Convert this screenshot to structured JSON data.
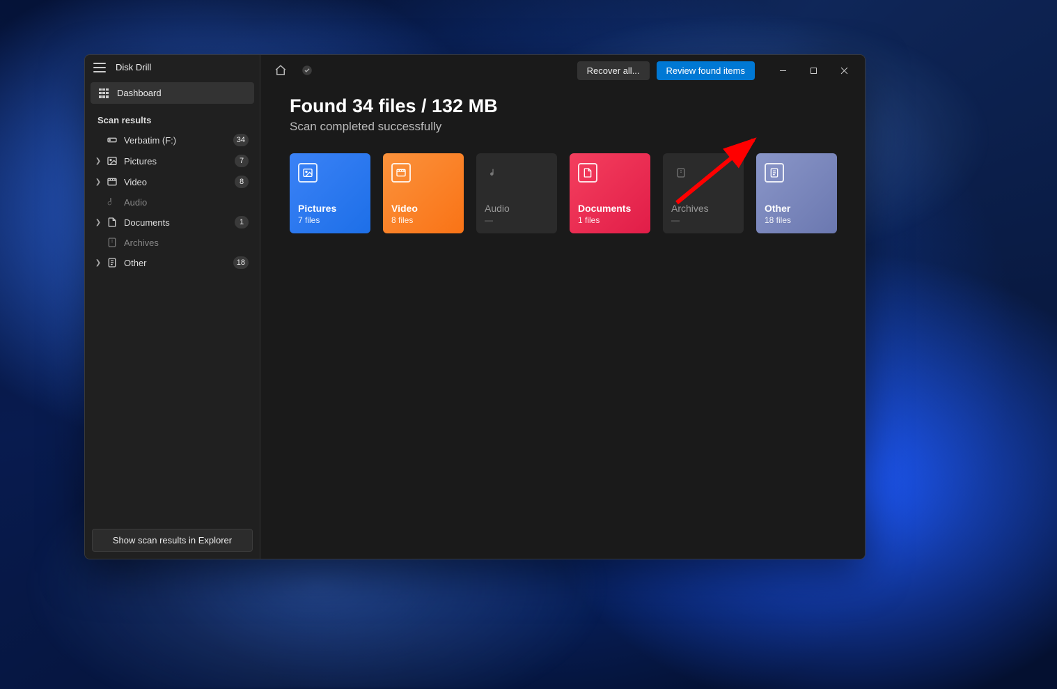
{
  "app": {
    "title": "Disk Drill"
  },
  "sidebar": {
    "dashboard_label": "Dashboard",
    "section_title": "Scan results",
    "items": [
      {
        "label": "Verbatim (F:)",
        "count": "34",
        "icon": "drive",
        "expandable": false,
        "dim": false
      },
      {
        "label": "Pictures",
        "count": "7",
        "icon": "image",
        "expandable": true,
        "dim": false
      },
      {
        "label": "Video",
        "count": "8",
        "icon": "video",
        "expandable": true,
        "dim": false
      },
      {
        "label": "Audio",
        "count": "",
        "icon": "audio",
        "expandable": false,
        "dim": true
      },
      {
        "label": "Documents",
        "count": "1",
        "icon": "doc",
        "expandable": true,
        "dim": false
      },
      {
        "label": "Archives",
        "count": "",
        "icon": "archive",
        "expandable": false,
        "dim": true
      },
      {
        "label": "Other",
        "count": "18",
        "icon": "other",
        "expandable": true,
        "dim": false
      }
    ],
    "footer_button": "Show scan results in Explorer"
  },
  "toolbar": {
    "recover_label": "Recover all...",
    "review_label": "Review found items"
  },
  "main": {
    "headline": "Found 34 files / 132 MB",
    "subhead": "Scan completed successfully"
  },
  "cards": [
    {
      "title": "Pictures",
      "count": "7 files",
      "style": "c-pictures",
      "icon": "image"
    },
    {
      "title": "Video",
      "count": "8 files",
      "style": "c-video",
      "icon": "video"
    },
    {
      "title": "Audio",
      "count": "—",
      "style": "dim",
      "icon": "audio"
    },
    {
      "title": "Documents",
      "count": "1 files",
      "style": "c-docs",
      "icon": "doc"
    },
    {
      "title": "Archives",
      "count": "—",
      "style": "dim",
      "icon": "archive"
    },
    {
      "title": "Other",
      "count": "18 files",
      "style": "c-other",
      "icon": "other"
    }
  ]
}
